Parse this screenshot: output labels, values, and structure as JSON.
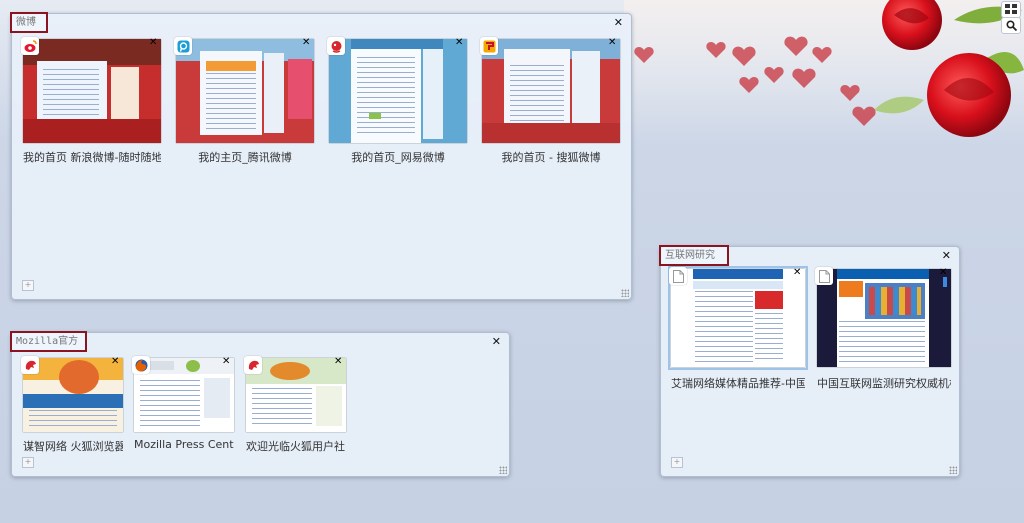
{
  "groups": [
    {
      "id": "weibo",
      "title": "微博",
      "tabs": [
        {
          "label": "我的首页 新浪微博-随时随地",
          "favicon": "sina-weibo-icon",
          "color": "#e6162d"
        },
        {
          "label": "我的主页_腾讯微博",
          "favicon": "tencent-weibo-icon",
          "color": "#1b9ed8"
        },
        {
          "label": "我的首页_网易微博",
          "favicon": "netease-weibo-icon",
          "color": "#d8262e"
        },
        {
          "label": "我的首页 - 搜狐微博",
          "favicon": "sohu-weibo-icon",
          "color": "#f2a900"
        }
      ]
    },
    {
      "id": "mozilla",
      "title": "Mozilla官方",
      "tabs": [
        {
          "label": "谋智网络 火狐浏览器",
          "favicon": "mozilla-dino-icon",
          "color": "#d8262e"
        },
        {
          "label": "Mozilla Press Center",
          "favicon": "firefox-icon",
          "color": "#e66000"
        },
        {
          "label": "欢迎光临火狐用户社区",
          "favicon": "mozilla-dino-icon",
          "color": "#d8262e"
        }
      ]
    },
    {
      "id": "research",
      "title": "互联网研究",
      "tabs": [
        {
          "label": "艾瑞网络媒体精品推荐-中国",
          "favicon": "blank-page-icon",
          "color": "#888888"
        },
        {
          "label": "中国互联网监测研究权威机构",
          "favicon": "blank-page-icon",
          "color": "#888888"
        }
      ]
    }
  ],
  "colors": {
    "title_border": "#8a1420",
    "group_bg": "#e8f0fa"
  }
}
